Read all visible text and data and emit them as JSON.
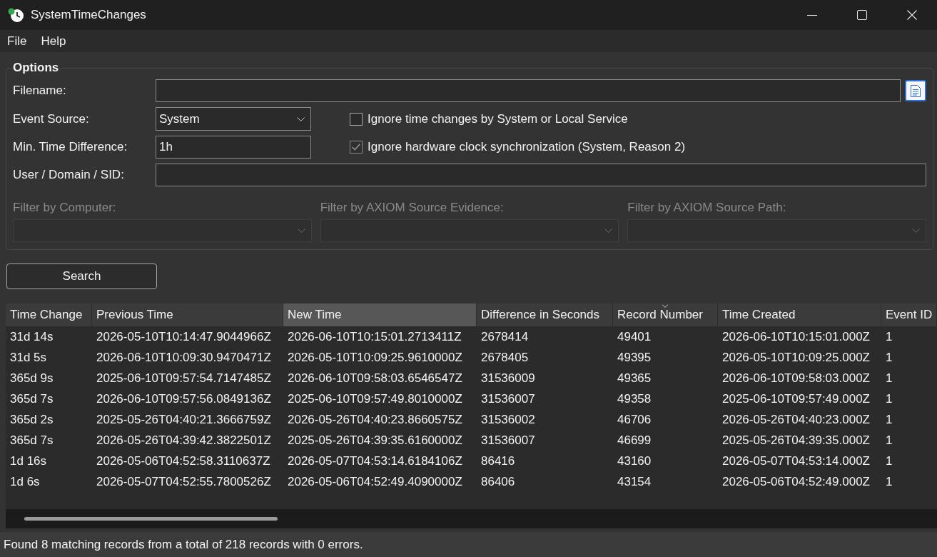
{
  "window": {
    "title": "SystemTimeChanges"
  },
  "menu": [
    {
      "label": "File"
    },
    {
      "label": "Help"
    }
  ],
  "options": {
    "title": "Options",
    "filename": {
      "label": "Filename:"
    },
    "event_source": {
      "label": "Event Source:",
      "value": "System"
    },
    "min_time_difference": {
      "label": "Min. Time Difference:",
      "value": "1h"
    },
    "user_domain_sid": {
      "label": "User / Domain / SID:"
    },
    "checkboxes": [
      {
        "label": "Ignore time changes by System or Local Service",
        "checked": false
      },
      {
        "label": "Ignore hardware clock synchronization (System, Reason 2)",
        "checked": true
      }
    ],
    "filters": [
      {
        "label": "Filter by Computer:",
        "disabled": true
      },
      {
        "label": "Filter by AXIOM Source Evidence:",
        "disabled": true
      },
      {
        "label": "Filter by AXIOM Source Path:",
        "disabled": true
      }
    ]
  },
  "search_button": {
    "label": "Search"
  },
  "table": {
    "columns": [
      {
        "label": "Time Change",
        "sorted": false,
        "highlighted": false
      },
      {
        "label": "Previous Time",
        "sorted": false,
        "highlighted": false
      },
      {
        "label": "New Time",
        "sorted": false,
        "highlighted": true
      },
      {
        "label": "Difference in Seconds",
        "sorted": false,
        "highlighted": false
      },
      {
        "label": "Record Number",
        "sorted": true,
        "highlighted": false
      },
      {
        "label": "Time Created",
        "sorted": false,
        "highlighted": false
      },
      {
        "label": "Event ID",
        "sorted": false,
        "highlighted": false
      }
    ],
    "rows": [
      {
        "selected": false,
        "cells": [
          "31d 14s",
          "2026-05-10T10:14:47.9044966Z",
          "2026-06-10T10:15:01.2713411Z",
          "2678414",
          "49401",
          "2026-06-10T10:15:01.000Z",
          "1"
        ]
      },
      {
        "selected": false,
        "cells": [
          "31d 5s",
          "2026-06-10T10:09:30.9470471Z",
          "2026-05-10T10:09:25.9610000Z",
          "2678405",
          "49395",
          "2026-05-10T10:09:25.000Z",
          "1"
        ]
      },
      {
        "selected": false,
        "cells": [
          "365d 9s",
          "2025-06-10T09:57:54.7147485Z",
          "2026-06-10T09:58:03.6546547Z",
          "31536009",
          "49365",
          "2026-06-10T09:58:03.000Z",
          "1"
        ]
      },
      {
        "selected": false,
        "cells": [
          "365d 7s",
          "2026-06-10T09:57:56.0849136Z",
          "2025-06-10T09:57:49.8010000Z",
          "31536007",
          "49358",
          "2025-06-10T09:57:49.000Z",
          "1"
        ]
      },
      {
        "selected": false,
        "cells": [
          "365d 2s",
          "2025-05-26T04:40:21.3666759Z",
          "2026-05-26T04:40:23.8660575Z",
          "31536002",
          "46706",
          "2026-05-26T04:40:23.000Z",
          "1"
        ]
      },
      {
        "selected": false,
        "cells": [
          "365d 7s",
          "2026-05-26T04:39:42.3822501Z",
          "2025-05-26T04:39:35.6160000Z",
          "31536007",
          "46699",
          "2025-05-26T04:39:35.000Z",
          "1"
        ]
      },
      {
        "selected": false,
        "cells": [
          "1d 16s",
          "2026-05-06T04:52:58.3110637Z",
          "2026-05-07T04:53:14.6184106Z",
          "86416",
          "43160",
          "2026-05-07T04:53:14.000Z",
          "1"
        ]
      },
      {
        "selected": false,
        "cells": [
          "1d 6s",
          "2026-05-07T04:52:55.7800526Z",
          "2026-05-06T04:52:49.4090000Z",
          "86406",
          "43154",
          "2026-05-06T04:52:49.000Z",
          "1"
        ]
      }
    ]
  },
  "status_bar": {
    "text": "Found 8 matching records from a total of 218 records with 0 errors."
  }
}
